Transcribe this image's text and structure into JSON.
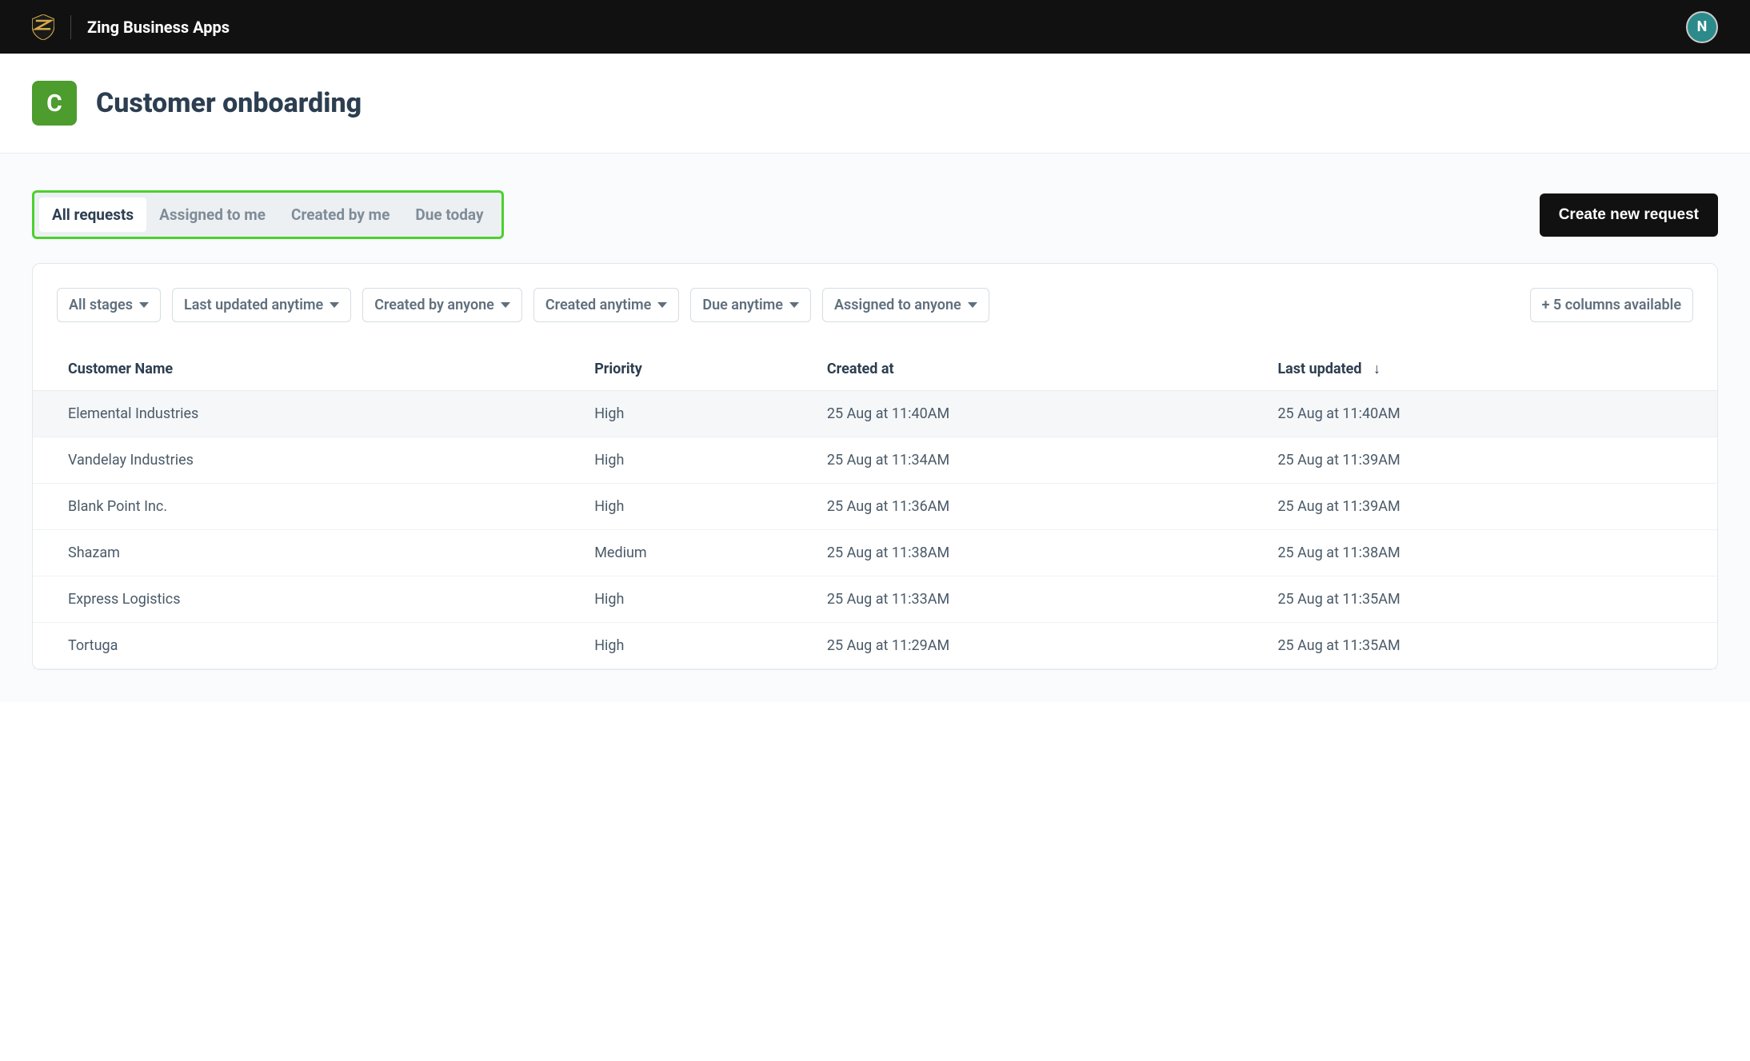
{
  "topbar": {
    "app_name": "Zing Business Apps",
    "avatar_initial": "N"
  },
  "page": {
    "icon_letter": "C",
    "title": "Customer onboarding"
  },
  "tabs": {
    "items": [
      {
        "label": "All requests",
        "active": true
      },
      {
        "label": "Assigned to me",
        "active": false
      },
      {
        "label": "Created by me",
        "active": false
      },
      {
        "label": "Due today",
        "active": false
      }
    ]
  },
  "actions": {
    "create_label": "Create new request"
  },
  "filters": {
    "items": [
      {
        "label": "All stages"
      },
      {
        "label": "Last updated anytime"
      },
      {
        "label": "Created by anyone"
      },
      {
        "label": "Created anytime"
      },
      {
        "label": "Due anytime"
      },
      {
        "label": "Assigned to anyone"
      }
    ],
    "columns_available_label": "+ 5 columns available"
  },
  "table": {
    "columns": [
      {
        "label": "Customer Name",
        "sort": ""
      },
      {
        "label": "Priority",
        "sort": ""
      },
      {
        "label": "Created at",
        "sort": ""
      },
      {
        "label": "Last updated",
        "sort": "desc"
      }
    ],
    "rows": [
      {
        "customer": "Elemental Industries",
        "priority": "High",
        "created": "25 Aug at 11:40AM",
        "updated": "25 Aug at 11:40AM"
      },
      {
        "customer": "Vandelay Industries",
        "priority": "High",
        "created": "25 Aug at 11:34AM",
        "updated": "25 Aug at 11:39AM"
      },
      {
        "customer": "Blank Point Inc.",
        "priority": "High",
        "created": "25 Aug at 11:36AM",
        "updated": "25 Aug at 11:39AM"
      },
      {
        "customer": "Shazam",
        "priority": "Medium",
        "created": "25 Aug at 11:38AM",
        "updated": "25 Aug at 11:38AM"
      },
      {
        "customer": "Express Logistics",
        "priority": "High",
        "created": "25 Aug at 11:33AM",
        "updated": "25 Aug at 11:35AM"
      },
      {
        "customer": "Tortuga",
        "priority": "High",
        "created": "25 Aug at 11:29AM",
        "updated": "25 Aug at 11:35AM"
      }
    ]
  }
}
